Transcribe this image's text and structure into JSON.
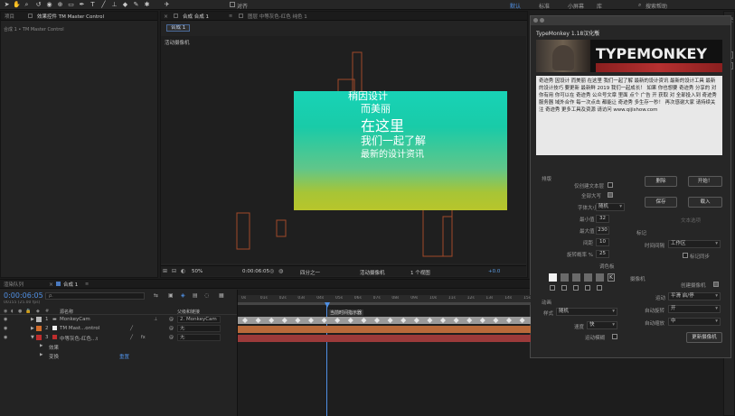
{
  "toolbar": {
    "align_label": "对齐",
    "workspaces": [
      {
        "label": "默认",
        "active": true
      },
      {
        "label": "标准",
        "active": false
      },
      {
        "label": "小屏幕",
        "active": false
      },
      {
        "label": "库",
        "active": false
      }
    ],
    "search_help": "搜索帮助"
  },
  "project_panel": {
    "tabs": [
      "项目",
      "效果控件 TM Master Control"
    ],
    "subtitle": "合成 1 • TM Master Control"
  },
  "comp_panel": {
    "tab_comp": "合成 合成 1",
    "tab_layer": "图层 中等灰色-红色 纯色 1",
    "subtab": "合成 1",
    "camera_label": "活动摄像机",
    "text_lines": [
      "稍因设计",
      "而美丽",
      "在这里",
      "我们一起了解",
      "最新的设计资讯"
    ],
    "bottom_bar": {
      "zoom": "50%",
      "timecode": "0:00:06:05",
      "resolution": "四分之一",
      "camera": "活动摄像机",
      "views": "1 个视图",
      "offset": "+0.0"
    }
  },
  "typemonkey": {
    "title": "TypeMonkey 1.18汉化版",
    "logo_text": "TYPEMONKEY",
    "textarea": "奇迹秀 因设计 而美丽 在这里 我们一起了解 最新的设计资讯 最新的设计工具 最新的设计技巧 要更新 最新鲜 2019 我们一起成长！ 如果 你也想要 奇迹秀 分享的 对你有用 你可以在 奇迹秀 公众号文章 里面 点个 广告 开 获取 对 全部投入到 奇迹秀服务器 域外合作 每一次点击 都能让 奇迹秀 多生存一秒！ 再次感谢大家 请持续关注 奇迹秀 更多工具及资源 请访问 www.qijishow.com",
    "sections": {
      "layout": "排版",
      "colors": "调色板",
      "markers": "标记",
      "camera": "摄像机",
      "animation": "动画",
      "text_options": "文本选项"
    },
    "layout_fields": {
      "only_text_layer": "仅创建文本层",
      "all_caps": "全部大写",
      "font_size_label": "字体大小",
      "font_size_value": "随机",
      "min_label": "最小值",
      "min_value": "32",
      "max_label": "最大值",
      "max_value": "230",
      "gap_label": "间距",
      "gap_value": "10",
      "rotation_label": "旋转概率 %",
      "rotation_value": "25"
    },
    "buttons": {
      "clear": "删除",
      "start": "开始！",
      "save": "保存",
      "load": "载入",
      "update_camera": "更新摄像机"
    },
    "markers_fields": {
      "time_interval_label": "时间间隔",
      "time_interval_value": "工作区",
      "sync_markers": "标记同步"
    },
    "camera_fields": {
      "create_camera": "创建摄像机",
      "motion_label": "运动",
      "motion_value": "平滑 启/停",
      "auto_rotate_label": "自动旋转",
      "auto_rotate_value": "开",
      "auto_zoom_label": "自动缩放",
      "auto_zoom_value": "中"
    },
    "animation_fields": {
      "style_label": "样式",
      "style_value": "随机",
      "speed_label": "速度",
      "speed_value": "快",
      "motion_blur": "运动模糊"
    },
    "side_label": "使"
  },
  "timeline": {
    "tabs": [
      "渲染队列",
      "合成 1"
    ],
    "timecode": "0:00:06:05",
    "frame_info": "00155 (25.00 fps)",
    "search_placeholder": "ρ.",
    "columns": {
      "name": "源名称",
      "parent": "父级和链接"
    },
    "layers": [
      {
        "index": "1",
        "color": "#b9b9b9",
        "name": "MonkeyCam",
        "parent": "2. MonkeyCam"
      },
      {
        "index": "2",
        "color": "#d46d2b",
        "name": "TM Mast...ontrol",
        "parent": "无"
      },
      {
        "index": "3",
        "color": "#c02d2d",
        "name": "中等灰色-红色...t",
        "parent": "无"
      }
    ],
    "sublayers": [
      {
        "name": "效果",
        "value": ""
      },
      {
        "name": "变换",
        "value": "重置"
      }
    ],
    "time_indicator": "当前时间指示器",
    "ruler": [
      "0s",
      "01s",
      "02s",
      "03s",
      "04s",
      "05s",
      "06s",
      "07s",
      "08s",
      "09s",
      "10s",
      "11s",
      "12s",
      "13s",
      "14s",
      "15s"
    ]
  }
}
